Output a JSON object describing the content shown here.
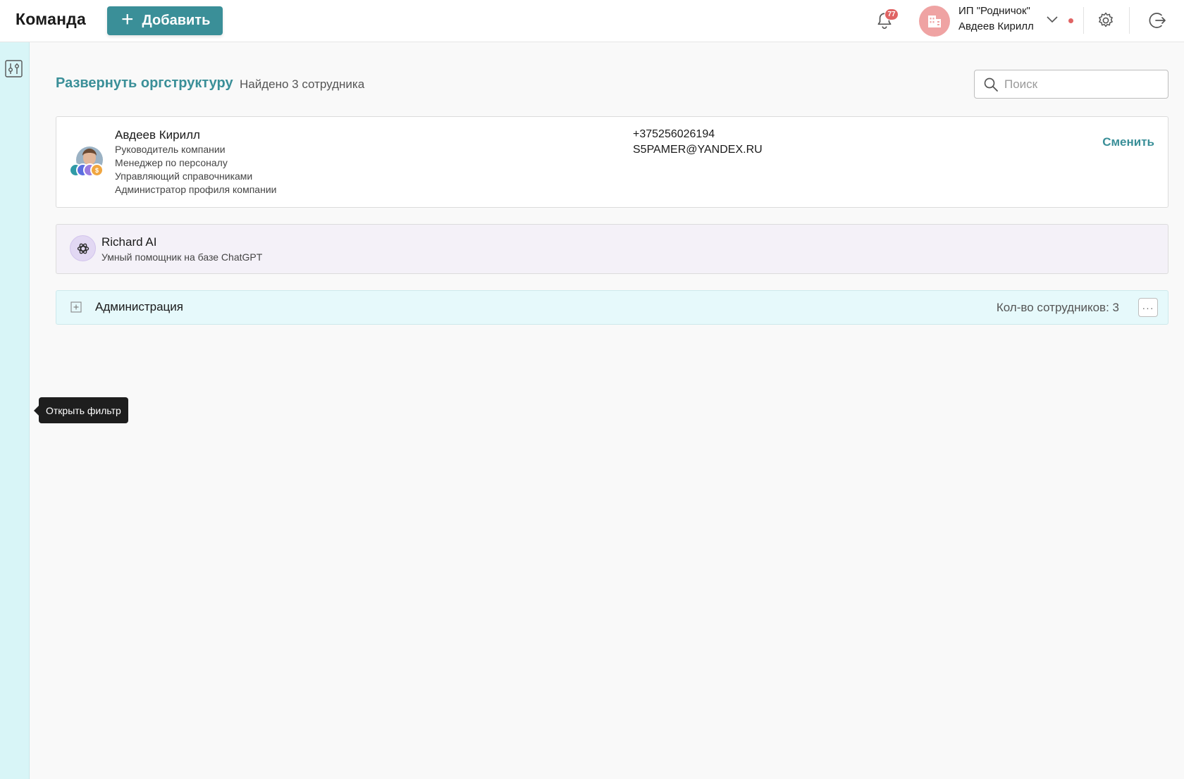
{
  "header": {
    "title": "Команда",
    "add_label": "Добавить",
    "add_icon": "plus-icon",
    "notifications_count": "77",
    "company_name": "ИП \"Родничок\"",
    "company_user": "Авдеев Кирилл"
  },
  "sidebar": {
    "filter_icon": "sliders-icon",
    "tooltip": "Открыть фильтр"
  },
  "toolbar": {
    "expand_link": "Развернуть оргструктуру",
    "found_text": "Найдено 3 сотрудника",
    "search_placeholder": "Поиск"
  },
  "person": {
    "name": "Авдеев Кирилл",
    "roles": [
      "Руководитель компании",
      "Менеджер по персоналу",
      "Управляющий справочниками",
      "Администратор профиля компании"
    ],
    "role_badges": [
      {
        "letter": "",
        "color": "#2f9aa6"
      },
      {
        "letter": "",
        "color": "#5b6ee0"
      },
      {
        "letter": "",
        "color": "#9a7be0"
      },
      {
        "letter": "$",
        "color": "#f0a640"
      }
    ],
    "phone": "+375256026194",
    "email": "S5PAMER@YANDEX.RU",
    "change_label": "Сменить"
  },
  "ai": {
    "name": "Richard AI",
    "description": "Умный помощник на базе ChatGPT"
  },
  "department": {
    "name": "Администрация",
    "count_text": "Кол-во сотрудников: 3",
    "more_label": "···"
  },
  "colors": {
    "accent": "#3a8f98",
    "sidebar_bg": "#d8f5f7",
    "badge_red": "#e06464",
    "ai_bg": "#f4f1f8",
    "dept_bg": "#e6f9fb"
  }
}
